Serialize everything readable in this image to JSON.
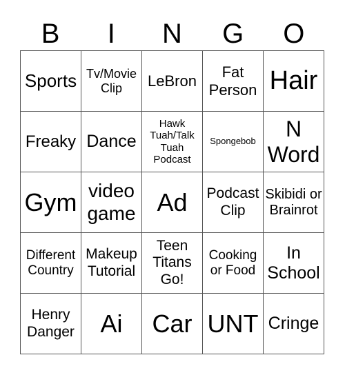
{
  "header": {
    "letters": [
      "B",
      "I",
      "N",
      "G",
      "O"
    ]
  },
  "board": {
    "rows": [
      [
        "Sports",
        "Tv/Movie Clip",
        "LeBron",
        "Fat Person",
        "Hair"
      ],
      [
        "Freaky",
        "Dance",
        "Hawk Tuah/Talk Tuah Podcast",
        "Spongebob",
        "N Word"
      ],
      [
        "Gym",
        "video game",
        "Ad",
        "Podcast Clip",
        "Skibidi or Brainrot"
      ],
      [
        "Different Country",
        "Makeup Tutorial",
        "Teen Titans Go!",
        "Cooking or Food",
        "In School"
      ],
      [
        "Henry Danger",
        "Ai",
        "Car",
        "UNT",
        "Cringe"
      ]
    ]
  },
  "colors": {
    "grid_line": "#555555",
    "text": "#000000",
    "background": "#ffffff"
  }
}
